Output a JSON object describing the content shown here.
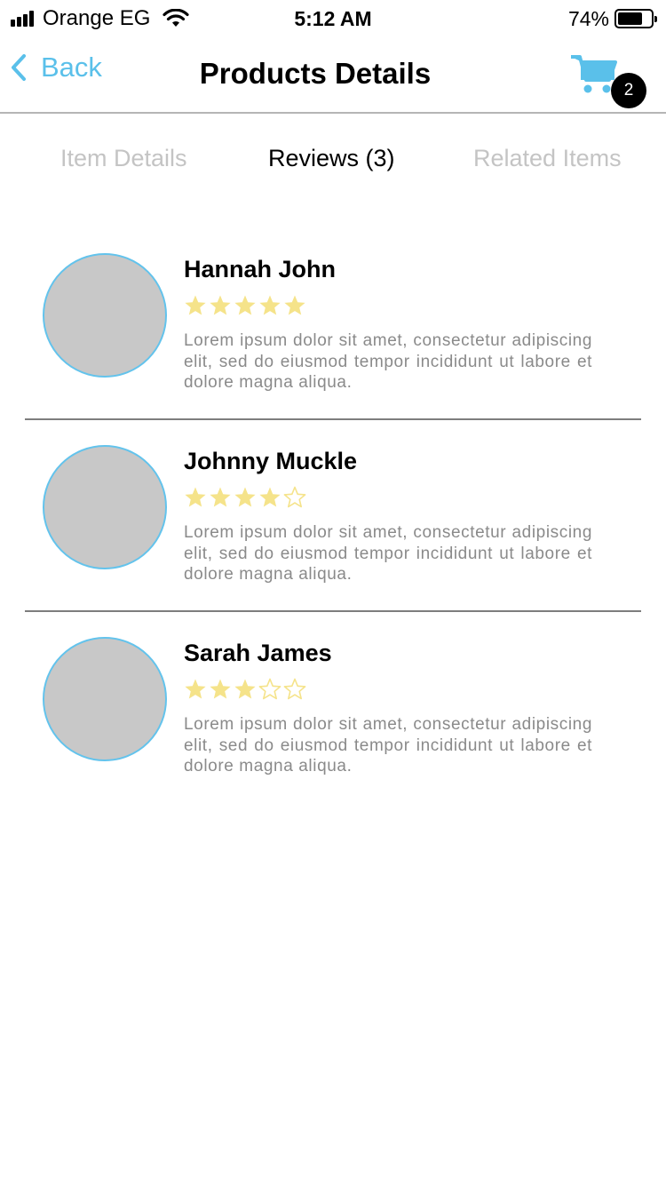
{
  "status_bar": {
    "carrier": "Orange EG",
    "time": "5:12 AM",
    "battery": "74%",
    "battery_level": 0.74
  },
  "nav": {
    "back_label": "Back",
    "title": "Products Details",
    "cart_count": "2",
    "accent_color": "#5ac0ea"
  },
  "tabs": [
    {
      "label": "Item Details",
      "active": false
    },
    {
      "label": "Reviews (3)",
      "active": true
    },
    {
      "label": "Related Items",
      "active": false
    }
  ],
  "reviews": [
    {
      "name": "Hannah John",
      "rating": 5,
      "max_rating": 5,
      "text": "Lorem ipsum dolor sit amet, consectetur adipiscing elit, sed do eiusmod tempor incididunt ut labore et dolore magna aliqua."
    },
    {
      "name": "Johnny Muckle",
      "rating": 4,
      "max_rating": 5,
      "text": "Lorem ipsum dolor sit amet, consectetur adipiscing elit, sed do eiusmod tempor incididunt ut labore et dolore magna aliqua."
    },
    {
      "name": "Sarah James",
      "rating": 3,
      "max_rating": 5,
      "text": "Lorem ipsum dolor sit amet, consectetur adipiscing elit, sed do eiusmod tempor incididunt ut labore et dolore magna aliqua."
    }
  ],
  "colors": {
    "star_filled": "#f5e38a",
    "star_empty_outline": "#f5e38a",
    "avatar_fill": "#c8c8c8",
    "avatar_border": "#63c3ec"
  }
}
